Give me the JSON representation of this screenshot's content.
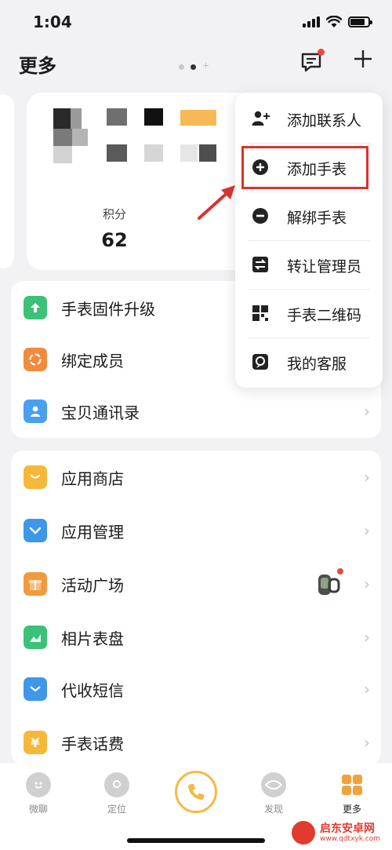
{
  "status_bar": {
    "time": "1:04"
  },
  "header": {
    "title": "更多"
  },
  "card": {
    "score_label": "积分",
    "score_value": "62"
  },
  "group1": {
    "items": [
      {
        "label": "手表固件升级",
        "icon": "upgrade-arrow-icon",
        "color": "#3cc178"
      },
      {
        "label": "绑定成员",
        "icon": "bind-member-icon",
        "color": "#f08a3c"
      },
      {
        "label": "宝贝通讯录",
        "icon": "contacts-icon",
        "color": "#4a9ff0"
      }
    ]
  },
  "group2": {
    "items": [
      {
        "label": "应用商店",
        "icon": "app-store-icon",
        "color": "#f6b83a"
      },
      {
        "label": "应用管理",
        "icon": "app-manage-icon",
        "color": "#3f97ea"
      },
      {
        "label": "活动广场",
        "icon": "gift-icon",
        "color": "#f19a3e"
      },
      {
        "label": "相片表盘",
        "icon": "photo-icon",
        "color": "#3cc178"
      },
      {
        "label": "代收短信",
        "icon": "sms-icon",
        "color": "#3f97ea"
      },
      {
        "label": "手表话费",
        "icon": "yuan-icon",
        "color": "#f6b83a",
        "glyph": "¥"
      }
    ]
  },
  "popup_menu": {
    "items": [
      {
        "label": "添加联系人",
        "icon": "add-contact-icon"
      },
      {
        "label": "添加手表",
        "icon": "add-circle-icon"
      },
      {
        "label": "解绑手表",
        "icon": "minus-circle-icon"
      },
      {
        "label": "转让管理员",
        "icon": "transfer-icon"
      },
      {
        "label": "手表二维码",
        "icon": "qrcode-icon"
      },
      {
        "label": "我的客服",
        "icon": "service-icon"
      }
    ],
    "highlight_color": "#d9322f"
  },
  "tab_bar": {
    "tabs": [
      {
        "label": "微聊"
      },
      {
        "label": "定位"
      },
      {
        "label": "发现"
      },
      {
        "label": "更多"
      }
    ],
    "accent": "#f5b942"
  },
  "watermark": {
    "title": "启东安卓网",
    "url": "www.qdtxyk.com"
  }
}
